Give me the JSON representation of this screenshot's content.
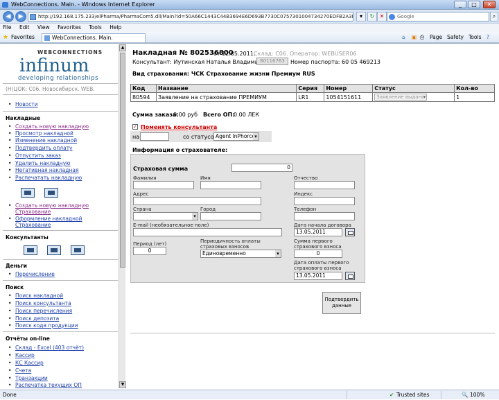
{
  "window": {
    "title": "WebConnections. Main. - Windows Internet Explorer",
    "address": "http://192.168.175.233/elPharma/PharmaCom5.dll/Main?id=50A66C1443C44B3694E6D693B7730C0757301004734270EDFB2A3BEEE44B87816E0DB55CE95C21",
    "search_placeholder": "Google",
    "menu": [
      "File",
      "Edit",
      "View",
      "Favorites",
      "Tools",
      "Help"
    ],
    "favorites_label": "Favorites",
    "tab_title": "WebConnections. Main.",
    "commands": [
      "Page",
      "Safety",
      "Tools"
    ]
  },
  "sidebar": {
    "brand_top": "WEBCONNECTIONS",
    "brand_logo": "infinum",
    "brand_sub": "developing relationships",
    "location": "(Н)ЦОК: С06. Новосибирск. WEB.",
    "news": "Новости",
    "sections": {
      "invoices": "Накладные",
      "consultants": "Консультанты",
      "money": "Деньги",
      "search": "Поиск",
      "online_reports": "Отчёты on-line"
    },
    "invoice_links": [
      "Создать новую накладную",
      "Просмотр накладной",
      "Изменение накладной",
      "Подтвердить оплату",
      "Отпустить заказ",
      "Удалить накладную",
      "Негативная накладная",
      "Распечатать накладную"
    ],
    "insurance_links": [
      "Создать новую накладную Страхование",
      "Оформление накладной Страхование"
    ],
    "money_links": [
      "Перечисление"
    ],
    "search_links": [
      "Поиск накладной",
      "Поиск консультанта",
      "Поиск перечисления",
      "Поиск депозита",
      "Поиск кода продукции"
    ],
    "report_links": [
      "Склад - Excel (403 отчёт)",
      "Кассир",
      "КС Кассир",
      "Счета",
      "Транзакции",
      "Распечатка текущих ОП"
    ]
  },
  "invoice": {
    "title": "Накладная № 802536800",
    "date_text": "от 12.05.2011.",
    "meta_text": "Склад: С06. Оператор: WEBUSER06",
    "consultant_label": "Консультант: Иутинская Наталья Владимировна,",
    "consultant_id": "80116763",
    "passport_text": "Номер паспорта: 60 05 469213",
    "insurance_type": "Вид страхования:  ЧСК Страхование жизни Премиум RUS"
  },
  "table": {
    "headers": [
      "Код",
      "Название",
      "Серия",
      "Номер",
      "Статус",
      "Кол-во"
    ],
    "rows": [
      {
        "code": "80594",
        "name": "Заявление на страхование ПРЕМИУМ",
        "series": "LR1",
        "number": "1054151611",
        "status": "Заявление выдано",
        "qty": "1"
      }
    ]
  },
  "totals": {
    "order_sum_label": "Сумма заказа:",
    "order_sum_value": "0.00 руб",
    "op_label": "Всего ОП:",
    "op_value": "0.00 ЛЕК"
  },
  "consultant_change": {
    "checkbox_mark": "✓",
    "link": "Поменять консультанта",
    "on_label": "на",
    "status_label": "со статусом",
    "status_value": "Agent InPhorce"
  },
  "form": {
    "heading": "Информация о страхователе:",
    "insured_sum_label": "Страховая сумма",
    "insured_sum_value": "0",
    "surname_label": "Фамилия",
    "name_label": "Имя",
    "patronymic_label": "Отчество",
    "address_label": "Адрес",
    "zip_label": "Индекс",
    "country_label": "Страна",
    "city_label": "Город",
    "phone_label": "Телефон",
    "email_label": "E-mail (необязательное поле)",
    "contract_start_label": "Дата начала договора",
    "contract_start_value": "13.05.2011",
    "period_label": "Период (лет)",
    "period_value": "0",
    "frequency_label": "Периодичность оплаты страховых взносов",
    "frequency_value": "Единовременно",
    "first_sum_label": "Сумма первого страхового взноса",
    "first_sum_value": "0",
    "first_date_label": "Дата оплаты первого страхового взноса",
    "first_date_value": "13.05.2011",
    "submit_label": "Подтвердить данные"
  },
  "status": {
    "text": "Done",
    "zone": "Trusted sites",
    "zoom": "100%"
  }
}
